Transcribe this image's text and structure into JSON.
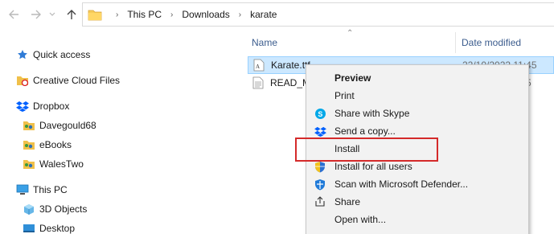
{
  "navigation": {
    "back_icon": "arrow-left-icon",
    "forward_icon": "arrow-right-icon",
    "recent_icon": "chevron-down-icon",
    "up_icon": "arrow-up-icon"
  },
  "address_bar": {
    "breadcrumbs": [
      "This PC",
      "Downloads",
      "karate"
    ]
  },
  "sidebar": {
    "items": [
      {
        "label": "Quick access",
        "icon": "star-icon"
      },
      {
        "label": "Creative Cloud Files",
        "icon": "creative-cloud-folder-icon"
      },
      {
        "label": "Dropbox",
        "icon": "dropbox-icon"
      },
      {
        "label": "Davegould68",
        "icon": "shared-folder-icon"
      },
      {
        "label": "eBooks",
        "icon": "shared-folder-icon"
      },
      {
        "label": "WalesTwo",
        "icon": "shared-folder-icon"
      },
      {
        "label": "This PC",
        "icon": "computer-icon"
      },
      {
        "label": "3D Objects",
        "icon": "3d-objects-icon"
      },
      {
        "label": "Desktop",
        "icon": "desktop-icon"
      }
    ]
  },
  "file_list": {
    "columns": {
      "name": "Name",
      "date_modified": "Date modified"
    },
    "files": [
      {
        "name": "Karate.ttf",
        "date": "22/10/2022 11:45",
        "icon": "font-file-icon",
        "selected": true
      },
      {
        "name": "READ_M",
        "date": "5",
        "icon": "text-file-icon",
        "selected": false
      }
    ]
  },
  "context_menu": {
    "items": [
      {
        "label": "Preview",
        "icon": "",
        "bold": true
      },
      {
        "label": "Print",
        "icon": "",
        "bold": false
      },
      {
        "label": "Share with Skype",
        "icon": "skype-icon",
        "bold": false
      },
      {
        "label": "Send a copy...",
        "icon": "dropbox-icon",
        "bold": false
      },
      {
        "label": "Install",
        "icon": "",
        "bold": false
      },
      {
        "label": "Install for all users",
        "icon": "shield-icon",
        "bold": false
      },
      {
        "label": "Scan with Microsoft Defender...",
        "icon": "defender-icon",
        "bold": false
      },
      {
        "label": "Share",
        "icon": "share-icon",
        "bold": false
      },
      {
        "label": "Open with...",
        "icon": "",
        "bold": false
      }
    ]
  },
  "colors": {
    "selection": "#cce8ff",
    "highlight_box": "#d42a2a",
    "column_header": "#3b5c8d"
  }
}
